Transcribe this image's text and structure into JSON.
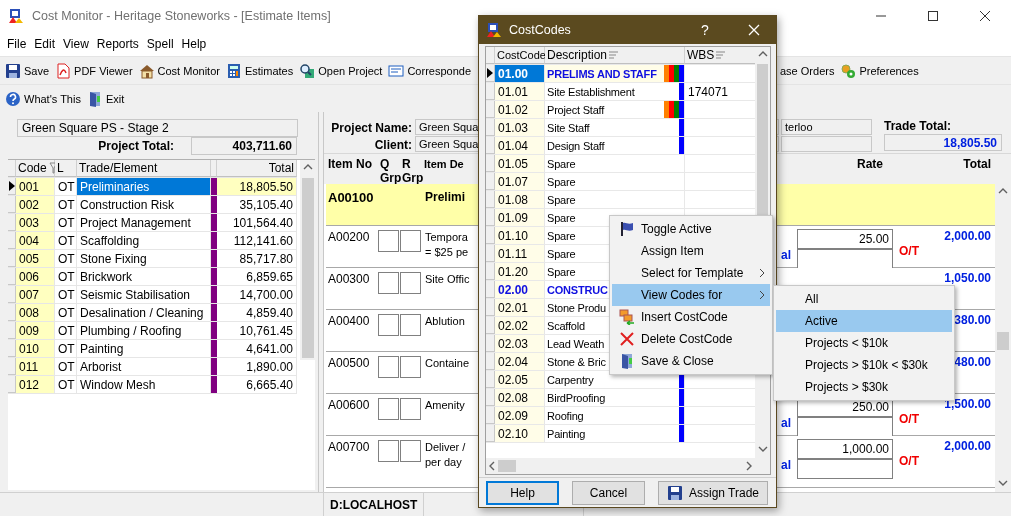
{
  "window": {
    "title": "Cost Monitor - Heritage Stoneworks - [Estimate Items]"
  },
  "menu": [
    "File",
    "Edit",
    "View",
    "Reports",
    "Spell",
    "Help"
  ],
  "toolbar": [
    "Save",
    "PDF Viewer",
    "Cost Monitor",
    "Estimates",
    "Open Project",
    "Corresponde"
  ],
  "toolbar_right": [
    "ase Orders",
    "Preferences"
  ],
  "toolbar2": [
    "What's This",
    "Exit"
  ],
  "project_panel": {
    "name": "Green Square PS - Stage 2",
    "total_label": "Project Total:",
    "total": "403,711.60"
  },
  "trades": {
    "columns": [
      "Code",
      "L",
      "Trade/Element",
      "Total"
    ],
    "rows": [
      {
        "code": "001",
        "l": "OT",
        "trade": "Preliminaries",
        "total": "18,805.50",
        "selected": true
      },
      {
        "code": "002",
        "l": "OT",
        "trade": "Construction Risk",
        "total": "35,105.40",
        "selected": false
      },
      {
        "code": "003",
        "l": "OT",
        "trade": "Project Management",
        "total": "101,564.40",
        "selected": false
      },
      {
        "code": "004",
        "l": "OT",
        "trade": "Scaffolding",
        "total": "112,141.60",
        "selected": false
      },
      {
        "code": "005",
        "l": "OT",
        "trade": "Stone Fixing",
        "total": "85,717.80",
        "selected": false
      },
      {
        "code": "006",
        "l": "OT",
        "trade": "Brickwork",
        "total": "6,859.65",
        "selected": false
      },
      {
        "code": "007",
        "l": "OT",
        "trade": "Seismic Stabilisation",
        "total": "14,700.00",
        "selected": false
      },
      {
        "code": "008",
        "l": "OT",
        "trade": "Desalination / Cleaning",
        "total": "4,859.40",
        "selected": false
      },
      {
        "code": "009",
        "l": "OT",
        "trade": "Plumbing / Roofing",
        "total": "10,761.45",
        "selected": false
      },
      {
        "code": "010",
        "l": "OT",
        "trade": "Painting",
        "total": "4,641.00",
        "selected": false
      },
      {
        "code": "011",
        "l": "OT",
        "trade": "Arborist",
        "total": "1,890.00",
        "selected": false
      },
      {
        "code": "012",
        "l": "OT",
        "trade": "Window Mesh",
        "total": "6,665.40",
        "selected": false
      }
    ]
  },
  "estimate": {
    "project_label": "Project Name:",
    "project": "Green Squa",
    "client_label": "Client:",
    "client": "Green Squa",
    "address": "terloo",
    "trade_total_label": "Trade Total:",
    "trade_total": "18,805.50",
    "columns": [
      "Item No",
      "Q Grp",
      "R Grp",
      "Item De",
      "Rate",
      "Total"
    ],
    "items": [
      {
        "kind": "heading",
        "item_no": "A00100",
        "description": [
          "Prelimi"
        ]
      },
      {
        "kind": "item",
        "item_no": "A00200",
        "description": [
          "Tempora",
          "= $25 pe"
        ],
        "label": "al",
        "rate": "25.00",
        "total": "2,000.00",
        "flag": "O/T"
      },
      {
        "kind": "item",
        "item_no": "A00300",
        "description": [
          "Site Offic"
        ],
        "total": "1,050.00"
      },
      {
        "kind": "item",
        "item_no": "A00400",
        "description": [
          "Ablution"
        ],
        "total": "380.00"
      },
      {
        "kind": "item",
        "item_no": "A00500",
        "description": [
          "Containe"
        ],
        "total": "480.00"
      },
      {
        "kind": "item",
        "item_no": "A00600",
        "description": [
          "Amenity"
        ],
        "label": "al",
        "rate": "250.00",
        "total": "1,500.00",
        "flag": "O/T"
      },
      {
        "kind": "item",
        "item_no": "A00700",
        "description": [
          "Deliver /",
          "per day"
        ],
        "label": "al",
        "rate": "1,000.00",
        "total": "2,000.00",
        "flag": "O/T"
      }
    ]
  },
  "status_bar": {
    "server": "D:LOCALHOST"
  },
  "dialog": {
    "title": "CostCodes",
    "help_glyph": "?",
    "columns": [
      "CostCode",
      "Description",
      "WBS"
    ],
    "rows": [
      {
        "kind": "heading",
        "code": "01.00",
        "description": "PRELIMS AND STAFF",
        "selected": true,
        "marks": [
          {
            "color": "#ff8000"
          },
          {
            "color": "#ff0000"
          },
          {
            "color": "#008000"
          },
          {
            "color": "#0000ff"
          }
        ]
      },
      {
        "kind": "code",
        "code": "01.01",
        "description": "Site Establishment",
        "wbs": "174071",
        "selected": false,
        "marks": [
          {
            "color": "#0000ff"
          }
        ]
      },
      {
        "kind": "code",
        "code": "01.02",
        "description": "Project Staff",
        "selected": false,
        "marks": [
          {
            "color": "#ff8000"
          },
          {
            "color": "#ff0000"
          },
          {
            "color": "#008000"
          },
          {
            "color": "#0000ff"
          }
        ]
      },
      {
        "kind": "code",
        "code": "01.03",
        "description": "Site Staff",
        "selected": false,
        "marks": [
          {
            "color": "#0000ff"
          }
        ]
      },
      {
        "kind": "code",
        "code": "01.04",
        "description": "Design Staff",
        "selected": false,
        "marks": [
          {
            "color": "#0000ff"
          }
        ]
      },
      {
        "kind": "code",
        "code": "01.05",
        "description": "Spare",
        "selected": false
      },
      {
        "kind": "code",
        "code": "01.07",
        "description": "Spare",
        "selected": false
      },
      {
        "kind": "code",
        "code": "01.08",
        "description": "Spare",
        "selected": false
      },
      {
        "kind": "code",
        "code": "01.09",
        "description": "Spare",
        "selected": false
      },
      {
        "kind": "code",
        "code": "01.10",
        "description": "Spare",
        "selected": false
      },
      {
        "kind": "code",
        "code": "01.11",
        "description": "Spare",
        "selected": false
      },
      {
        "kind": "code",
        "code": "01.20",
        "description": "Spare",
        "selected": false
      },
      {
        "kind": "heading",
        "code": "02.00",
        "description": "CONSTRUC",
        "selected": false
      },
      {
        "kind": "code",
        "code": "02.01",
        "description": "Stone Produ",
        "selected": false
      },
      {
        "kind": "code",
        "code": "02.02",
        "description": "Scaffold",
        "selected": false
      },
      {
        "kind": "code",
        "code": "02.03",
        "description": "Lead Weath",
        "selected": false
      },
      {
        "kind": "code",
        "code": "02.04",
        "description": "Stone & Bric",
        "selected": false
      },
      {
        "kind": "code",
        "code": "02.05",
        "description": "Carpentry",
        "selected": false,
        "marks": [
          {
            "color": "#0000ff"
          }
        ]
      },
      {
        "kind": "code",
        "code": "02.08",
        "description": "BirdProofing",
        "selected": false,
        "marks": [
          {
            "color": "#0000ff"
          }
        ]
      },
      {
        "kind": "code",
        "code": "02.09",
        "description": "Roofing",
        "selected": false,
        "marks": [
          {
            "color": "#0000ff"
          }
        ]
      },
      {
        "kind": "code",
        "code": "02.10",
        "description": "Painting",
        "selected": false,
        "marks": [
          {
            "color": "#0000ff"
          }
        ]
      }
    ],
    "buttons": [
      {
        "label": "Help",
        "default": true
      },
      {
        "label": "Cancel",
        "default": false
      },
      {
        "label": "Assign Trade",
        "default": false
      }
    ]
  },
  "context_menu": {
    "items": [
      {
        "label": "Toggle Active",
        "has_submenu": false,
        "highlighted": false
      },
      {
        "label": "Assign Item",
        "has_submenu": false,
        "highlighted": false
      },
      {
        "label": "Select for Template",
        "has_submenu": true,
        "highlighted": false
      },
      {
        "label": "View Codes for",
        "has_submenu": true,
        "highlighted": true
      },
      {
        "label": "Insert CostCode",
        "has_submenu": false,
        "highlighted": false
      },
      {
        "label": "Delete CostCode",
        "has_submenu": false,
        "highlighted": false
      },
      {
        "label": "Save & Close",
        "has_submenu": false,
        "highlighted": false
      }
    ],
    "submenu": [
      {
        "label": "All",
        "highlighted": false
      },
      {
        "label": "Active",
        "highlighted": true
      },
      {
        "label": "Projects < $10k",
        "highlighted": false
      },
      {
        "label": "Projects > $10k < $30k",
        "highlighted": false
      },
      {
        "label": "Projects > $30k",
        "highlighted": false
      }
    ]
  }
}
